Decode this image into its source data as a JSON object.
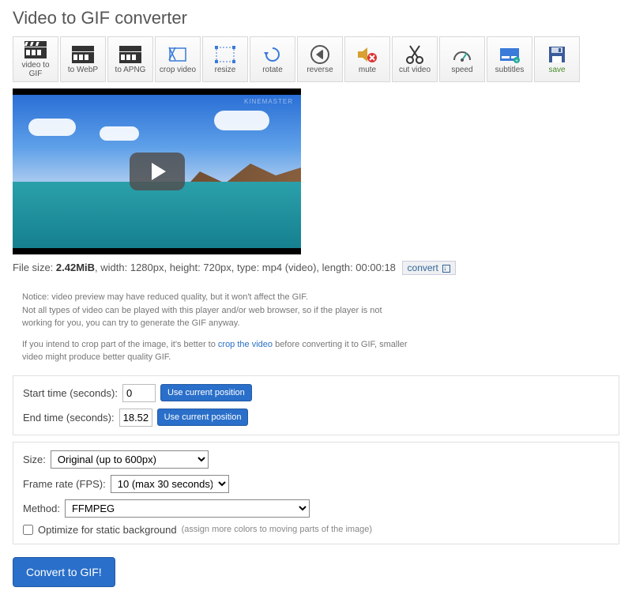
{
  "page": {
    "title": "Video to GIF converter"
  },
  "toolbar": [
    {
      "label": "video to GIF",
      "icon": "clapper"
    },
    {
      "label": "to WebP",
      "icon": "clapper"
    },
    {
      "label": "to APNG",
      "icon": "clapper"
    },
    {
      "label": "crop video",
      "icon": "crop"
    },
    {
      "label": "resize",
      "icon": "resize"
    },
    {
      "label": "rotate",
      "icon": "rotate"
    },
    {
      "label": "reverse",
      "icon": "reverse"
    },
    {
      "label": "mute",
      "icon": "mute"
    },
    {
      "label": "cut video",
      "icon": "cut"
    },
    {
      "label": "speed",
      "icon": "speed"
    },
    {
      "label": "subtitles",
      "icon": "subtitles"
    },
    {
      "label": "save",
      "icon": "save"
    }
  ],
  "video": {
    "watermark": "KINEMASTER"
  },
  "meta": {
    "prefix_size": "File size: ",
    "size": "2.42MiB",
    "rest": ", width: 1280px, height: 720px, type: mp4 (video), length: 00:00:18",
    "convert_label": "convert"
  },
  "notice": {
    "l1": "Notice: video preview may have reduced quality, but it won't affect the GIF.",
    "l2": "Not all types of video can be played with this player and/or web browser, so if the player is not working for you, you can try to generate the GIF anyway.",
    "l3a": "If you intend to crop part of the image, it's better to ",
    "l3link": "crop the video",
    "l3b": " before converting it to GIF, smaller video might produce better quality GIF."
  },
  "time": {
    "start_label": "Start time (seconds):",
    "start_value": "0",
    "end_label": "End time (seconds):",
    "end_value": "18.52",
    "use_pos": "Use current position"
  },
  "opts": {
    "size_label": "Size:",
    "size_value": "Original (up to 600px)",
    "fps_label": "Frame rate (FPS):",
    "fps_value": "10 (max 30 seconds)",
    "method_label": "Method:",
    "method_value": "FFMPEG",
    "opt_label": "Optimize for static background",
    "opt_hint": "(assign more colors to moving parts of the image)"
  },
  "submit": {
    "label": "Convert to GIF!"
  }
}
